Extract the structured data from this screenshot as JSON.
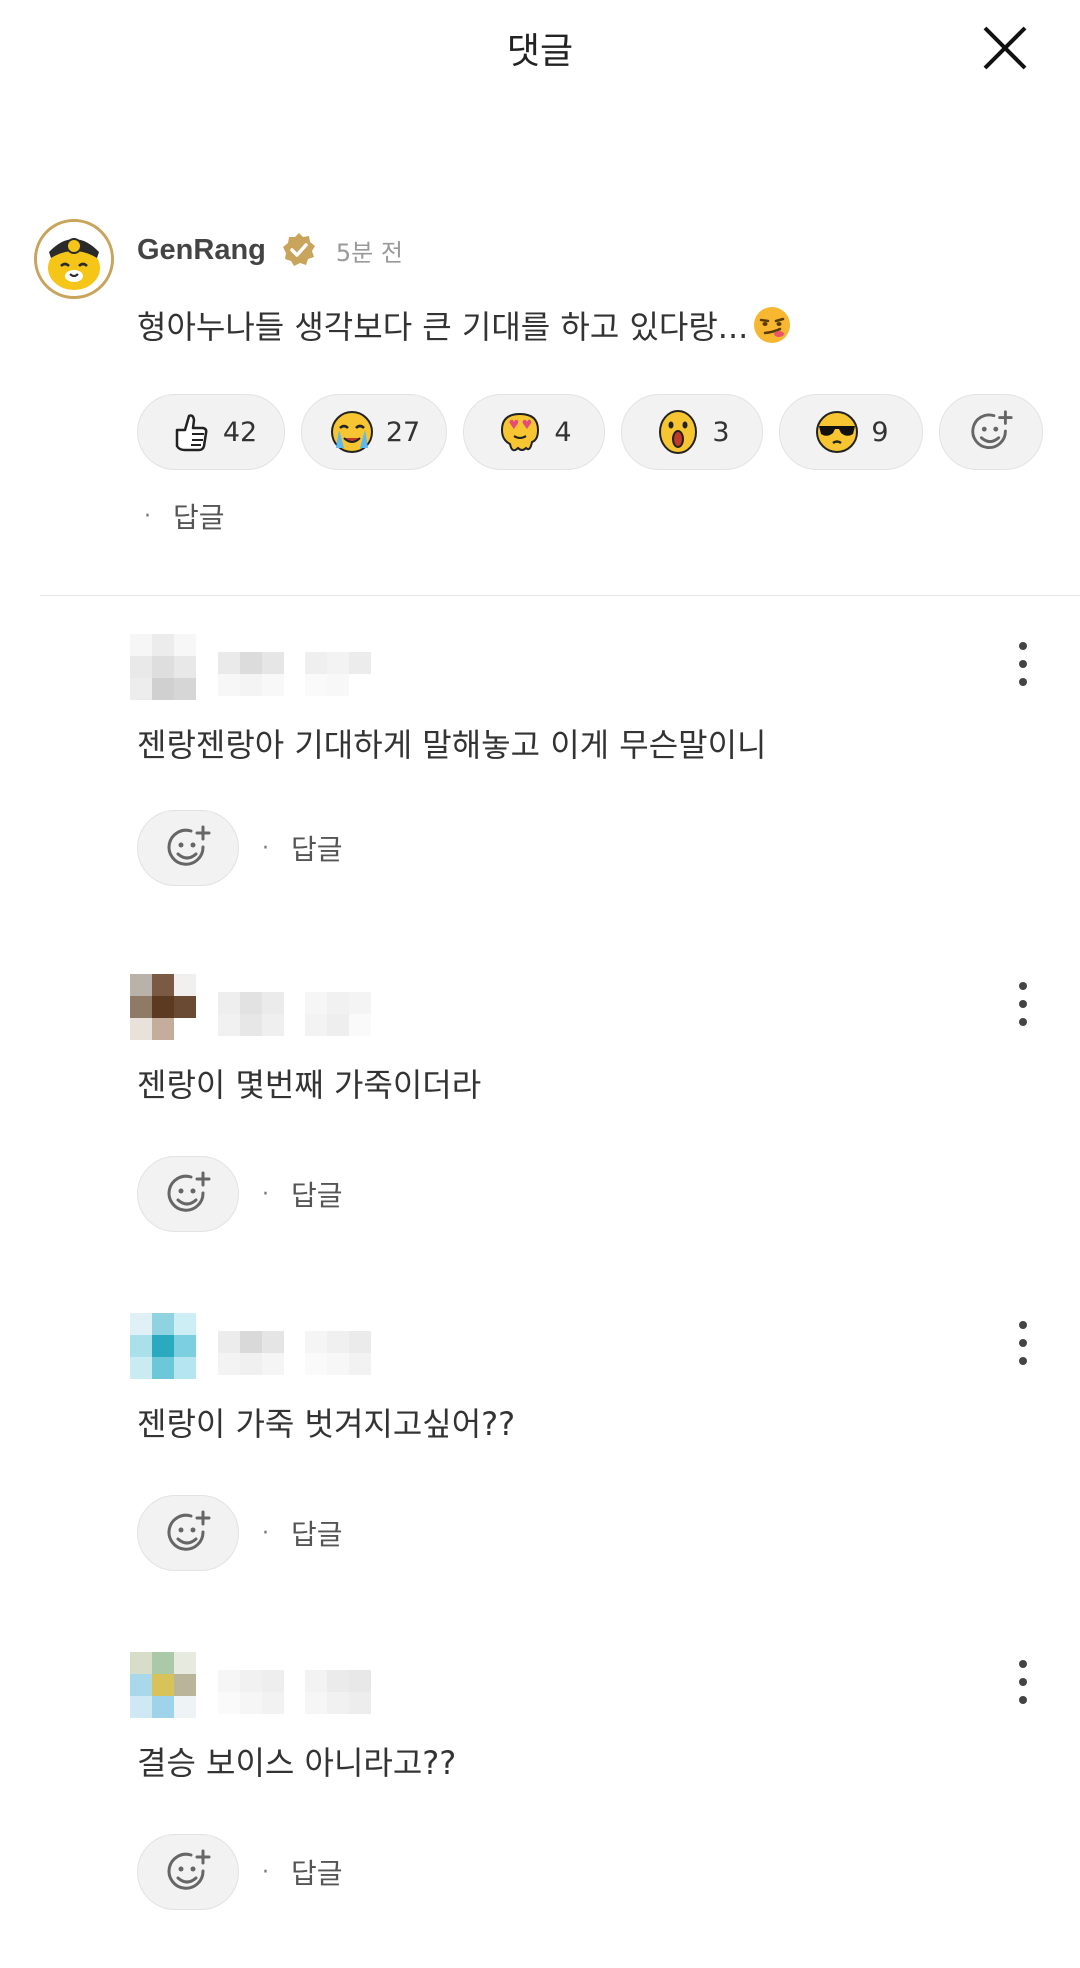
{
  "header": {
    "title": "댓글"
  },
  "main_comment": {
    "author": "GenRang",
    "time_ago": "5분 전",
    "text": "형아누나들 생각보다 큰 기대를 하고 있다랑...",
    "reactions": [
      {
        "icon": "thumbs-up-icon",
        "count": "42"
      },
      {
        "icon": "crying-face-icon",
        "count": "27"
      },
      {
        "icon": "heart-eyes-melting-face-icon",
        "count": "4"
      },
      {
        "icon": "surprised-face-icon",
        "count": "3"
      },
      {
        "icon": "sunglasses-face-icon",
        "count": "9"
      }
    ],
    "reply_label": "답글"
  },
  "comments": [
    {
      "text": "젠랑젠랑아 기대하게 말해놓고 이게 무슨말이니",
      "reply_label": "답글"
    },
    {
      "text": "젠랑이 몇번째 가죽이더라",
      "reply_label": "답글"
    },
    {
      "text": "젠랑이 가죽 벗겨지고싶어??",
      "reply_label": "답글"
    },
    {
      "text": "결승 보이스 아니라고??",
      "reply_label": "답글"
    }
  ],
  "colors": {
    "verified_badge": "#c9a45c",
    "tiger_yellow": "#f5c518"
  },
  "icons": {
    "close": "close-icon",
    "add_reaction": "smiley-plus-icon",
    "more": "kebab-menu-icon"
  }
}
